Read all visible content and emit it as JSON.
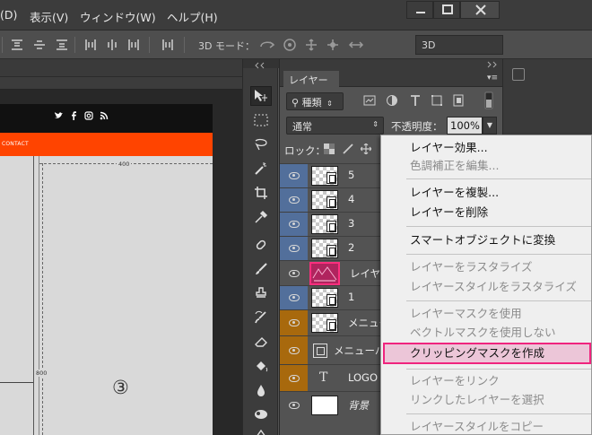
{
  "menubar": {
    "items": [
      "(D)",
      "表示(V)",
      "ウィンドウ(W)",
      "ヘルプ(H)"
    ]
  },
  "options_bar": {
    "mode_label": "3D モード：",
    "workspace_value": "3D"
  },
  "canvas": {
    "nav_text": "CONTACT",
    "dim_top": "400",
    "dim_side": "800",
    "annotation": "③",
    "social_icons": [
      "twitter-icon",
      "facebook-icon",
      "instagram-icon",
      "rss-icon"
    ]
  },
  "layers_panel": {
    "tab_label": "レイヤー",
    "filter_label": "種類",
    "blend_mode": "通常",
    "opacity_label": "不透明度：",
    "opacity_value": "100%",
    "lock_label": "ロック：",
    "layers": [
      {
        "name": "5",
        "eye_color": "blue"
      },
      {
        "name": "4",
        "eye_color": "blue"
      },
      {
        "name": "3",
        "eye_color": "blue"
      },
      {
        "name": "2",
        "eye_color": "blue"
      },
      {
        "name": "レイヤ",
        "eye_color": "none",
        "selected_thumb": true
      },
      {
        "name": "1",
        "eye_color": "blue"
      },
      {
        "name": "メニュー",
        "eye_color": "orange"
      },
      {
        "name": "メニューバ",
        "eye_color": "orange"
      },
      {
        "name": "LOGO",
        "eye_color": "orange"
      },
      {
        "name": "背景",
        "eye_color": "none"
      }
    ]
  },
  "context_menu": {
    "items": [
      {
        "label": "レイヤー効果...",
        "state": "enabled"
      },
      {
        "label": "色調補正を編集...",
        "state": "disabled"
      },
      {
        "label": "レイヤーを複製...",
        "state": "enabled"
      },
      {
        "label": "レイヤーを削除",
        "state": "enabled"
      },
      {
        "label": "スマートオブジェクトに変換",
        "state": "enabled"
      },
      {
        "label": "レイヤーをラスタライズ",
        "state": "disabled"
      },
      {
        "label": "レイヤースタイルをラスタライズ",
        "state": "disabled"
      },
      {
        "label": "レイヤーマスクを使用",
        "state": "disabled"
      },
      {
        "label": "ベクトルマスクを使用しない",
        "state": "disabled"
      },
      {
        "label": "クリッピングマスクを作成",
        "state": "highlight"
      },
      {
        "label": "レイヤーをリンク",
        "state": "disabled"
      },
      {
        "label": "リンクしたレイヤーを選択",
        "state": "disabled"
      },
      {
        "label": "レイヤースタイルをコピー",
        "state": "disabled"
      }
    ]
  },
  "colors": {
    "highlight_border": "#f0247e",
    "nav_orange": "#ff4400",
    "eye_blue": "#526f9b",
    "eye_orange": "#a8690d"
  }
}
